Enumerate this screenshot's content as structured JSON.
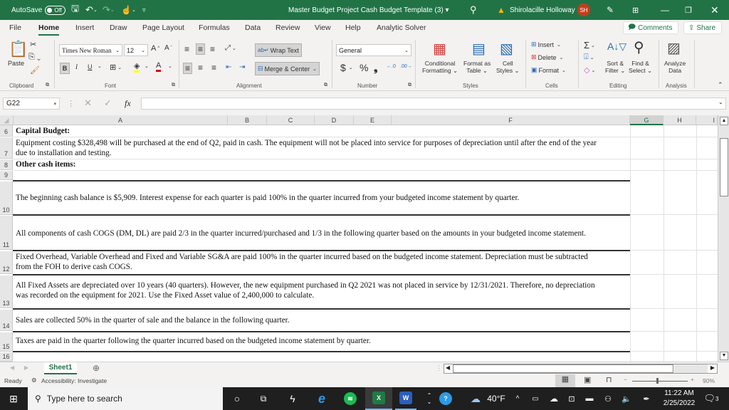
{
  "titlebar": {
    "autosave_label": "AutoSave",
    "autosave_state": "Off",
    "doc_title": "Master Budget Project Cash Budget Template (3)",
    "user_name": "Shirolacille Holloway",
    "user_initials": "SH",
    "accent_color": "#217346"
  },
  "tabs": [
    {
      "label": "File"
    },
    {
      "label": "Home",
      "active": true
    },
    {
      "label": "Insert"
    },
    {
      "label": "Draw"
    },
    {
      "label": "Page Layout"
    },
    {
      "label": "Formulas"
    },
    {
      "label": "Data"
    },
    {
      "label": "Review"
    },
    {
      "label": "View"
    },
    {
      "label": "Help"
    },
    {
      "label": "Analytic Solver"
    }
  ],
  "top_buttons": {
    "comments": "Comments",
    "share": "Share"
  },
  "ribbon": {
    "clipboard": {
      "paste": "Paste",
      "group": "Clipboard"
    },
    "font": {
      "name": "Times New Roman",
      "size": "12",
      "bold": "B",
      "italic": "I",
      "underline": "U",
      "grow": "A^",
      "shrink": "Aˇ",
      "group": "Font"
    },
    "alignment": {
      "wrap_text": "Wrap Text",
      "merge_center": "Merge & Center",
      "group": "Alignment"
    },
    "number": {
      "format": "General",
      "currency": "$",
      "percent": "%",
      "comma": "❟",
      "group": "Number"
    },
    "styles": {
      "conditional": "Conditional",
      "conditional2": "Formatting",
      "format_as": "Format as",
      "format_as2": "Table",
      "cell": "Cell",
      "cell2": "Styles",
      "group": "Styles"
    },
    "cells": {
      "insert": "Insert",
      "delete": "Delete",
      "format": "Format",
      "group": "Cells"
    },
    "editing": {
      "sort": "Sort &",
      "sort2": "Filter",
      "find": "Find &",
      "find2": "Select",
      "group": "Editing"
    },
    "analysis": {
      "analyze": "Analyze",
      "analyze2": "Data",
      "group": "Analysis"
    }
  },
  "formula_bar": {
    "name_box": "G22",
    "fx": "fx",
    "formula": ""
  },
  "columns": [
    "A",
    "B",
    "C",
    "D",
    "E",
    "F",
    "G",
    "H",
    "I"
  ],
  "rows": [
    {
      "num": "6",
      "text": "Capital  Budget:",
      "bold": true
    },
    {
      "num": "7",
      "text": "Equipment costing $328,498 will be purchased at the end of Q2, paid in cash. The equipment will not be placed into service for purposes of depreciation until after the end of the year",
      "text2": "due to installation and testing."
    },
    {
      "num": "8",
      "text": "Other cash items:",
      "bold": true
    },
    {
      "num": "9",
      "text": ""
    },
    {
      "num": "10",
      "text": "The beginning cash balance is $5,909.  Interest expense for each quarter is paid 100% in the quarter incurred from your budgeted income statement by quarter."
    },
    {
      "num": "11",
      "text": "All components of cash COGS (DM, DL) are paid 2/3 in the quarter incurred/purchased and 1/3 in the following quarter based on the amounts in your budgeted income statement."
    },
    {
      "num": "12",
      "text": "Fixed Overhead, Variable Overhead and Fixed and Variable SG&A are paid 100% in the quarter incurred based on the budgeted income statement. Depreciation must be subtracted",
      "text2": "from the FOH to derive cash COGS."
    },
    {
      "num": "13",
      "text": "All Fixed Assets are depreciated over 10 years (40 quarters).  However, the new equipment purchased in Q2 2021 was not placed in service by 12/31/2021.  Therefore, no depreciation",
      "text2": "was recorded on the equipment for 2021. Use the Fixed Asset value of 2,400,000 to calculate."
    },
    {
      "num": "14",
      "text": "Sales are collected 50% in the quarter of sale and the balance in the following quarter."
    },
    {
      "num": "15",
      "text": "Taxes are paid in the quarter following the quarter incurred based on the budgeted income statement by quarter."
    },
    {
      "num": "16",
      "text": ""
    }
  ],
  "sheets": [
    {
      "label": "Sheet1",
      "active": true
    }
  ],
  "status": {
    "ready": "Ready",
    "accessibility": "Accessibility: Investigate",
    "zoom": "90%"
  },
  "taskbar": {
    "search_placeholder": "Type here to search",
    "weather": "40°F",
    "time": "11:22 AM",
    "date": "2/25/2022",
    "notifications": "3"
  }
}
